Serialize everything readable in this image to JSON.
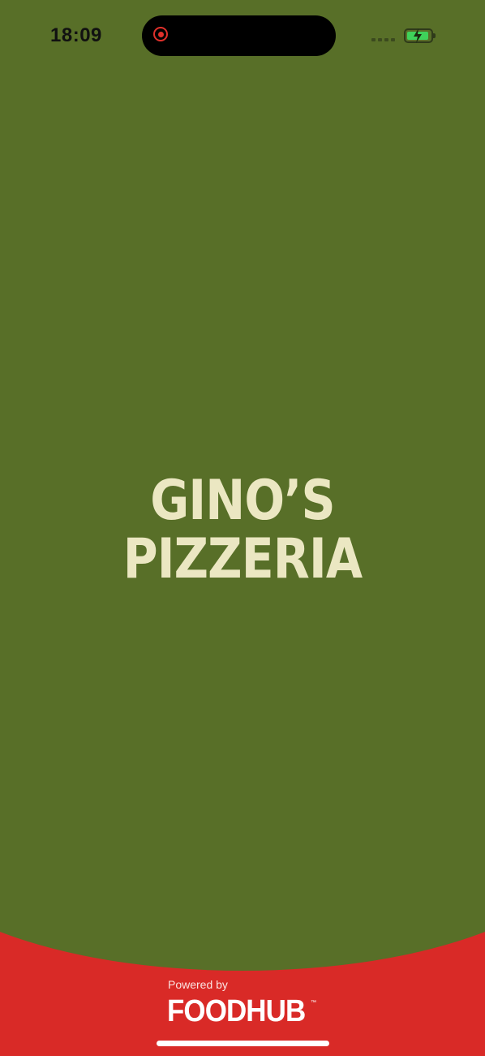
{
  "status_bar": {
    "time": "18:09",
    "battery_color": "#3FD25A"
  },
  "splash": {
    "brand_line1": "GINO’S",
    "brand_line2": "PIZZERIA",
    "background_color": "#586F28",
    "accent_color": "#D92A27",
    "logo_color": "#EBE7C2"
  },
  "footer": {
    "powered_by": "Powered by",
    "provider": "FOODHUB",
    "trademark": "™"
  }
}
